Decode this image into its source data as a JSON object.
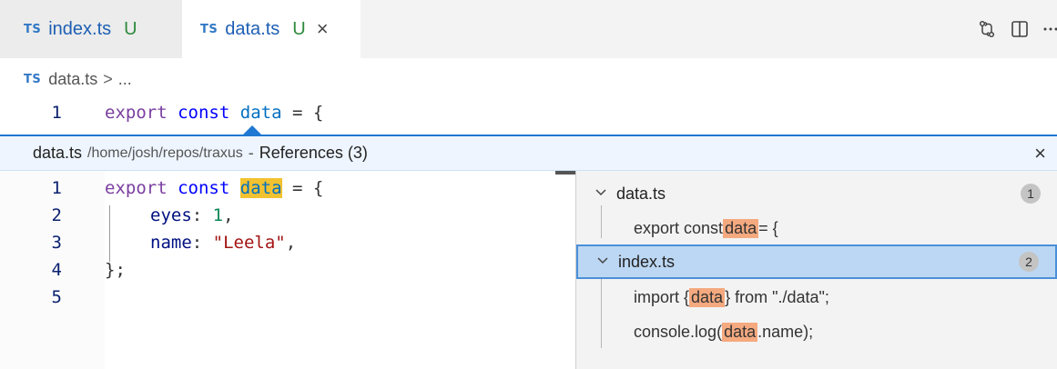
{
  "tabs": [
    {
      "lang": "TS",
      "name": "index.ts",
      "status": "U"
    },
    {
      "lang": "TS",
      "name": "data.ts",
      "status": "U",
      "close": "×"
    }
  ],
  "breadcrumb": {
    "lang": "TS",
    "file": "data.ts",
    "sep": ">",
    "rest": "..."
  },
  "editor": {
    "line1": {
      "number": "1",
      "kw_export": "export",
      "kw_const": "const",
      "ident": "data",
      "rest": " = {"
    }
  },
  "peek": {
    "file": "data.ts",
    "path": "/home/josh/repos/traxus",
    "dash": "-",
    "title": "References (3)",
    "close": "×",
    "lines": [
      {
        "n": "1",
        "export": "export",
        "const": "const",
        "ident": "data",
        "rest": " = {"
      },
      {
        "n": "2",
        "prop": "eyes",
        "colon": ": ",
        "num": "1",
        "end": ","
      },
      {
        "n": "3",
        "prop": "name",
        "colon": ": ",
        "str": "\"Leela\"",
        "end": ","
      },
      {
        "n": "4",
        "text": "};"
      },
      {
        "n": "5",
        "text": ""
      }
    ],
    "groups": [
      {
        "file": "data.ts",
        "count": "1",
        "items": [
          {
            "before": "export const ",
            "match": "data",
            "after": " = {"
          }
        ]
      },
      {
        "file": "index.ts",
        "count": "2",
        "items": [
          {
            "before": "import { ",
            "match": "data",
            "after": " } from \"./data\";"
          },
          {
            "before": "console.log(",
            "match": "data",
            "after": ".name);"
          }
        ]
      }
    ]
  },
  "icons": [
    "compare-changes-icon",
    "split-editor-icon",
    "more-actions-icon"
  ],
  "colors": {
    "accent": "#1f78d1",
    "match_highlight": "#f4a97f",
    "word_highlight": "#f2c230",
    "selected_row": "#bcd7f3"
  }
}
